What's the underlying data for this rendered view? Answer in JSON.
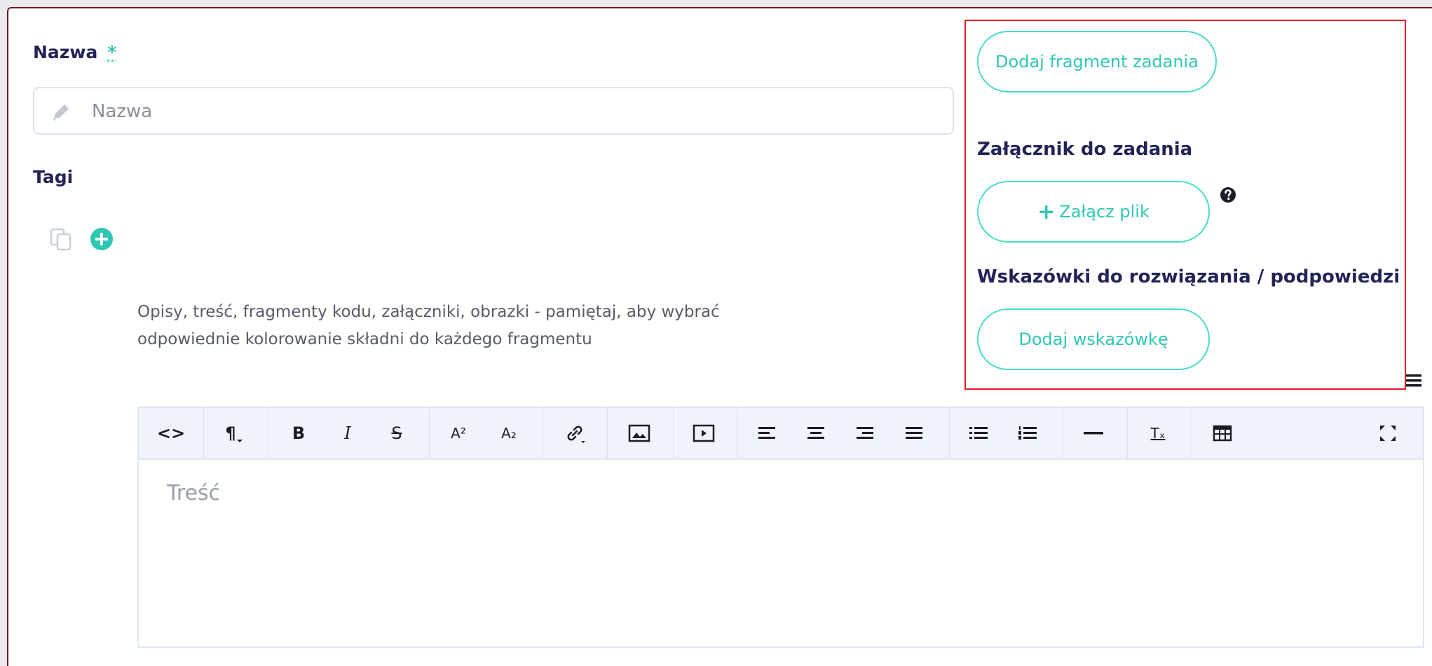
{
  "form": {
    "name_label": "Nazwa",
    "required_mark": "*",
    "name_placeholder": "Nazwa",
    "tags_label": "Tagi",
    "description": "Opisy, treść, fragmenty kodu, załączniki, obrazki - pamiętaj, aby wybrać odpowiednie kolorowanie składni do każdego fragmentu"
  },
  "panel": {
    "add_fragment_button": "Dodaj fragment zadania",
    "attachment_heading": "Załącznik do zadania",
    "attach_plus": "+",
    "attach_file_button": "Załącz plik",
    "hints_heading": "Wskazówki do rozwiązania / podpowiedzi",
    "add_hint_button": "Dodaj wskazówkę"
  },
  "editor": {
    "content_placeholder": "Treść",
    "toolbar": {
      "code_view": "<>",
      "paragraph": "¶",
      "bold": "B",
      "italic": "I",
      "strikethrough": "S",
      "superscript": "A²",
      "subscript": "A₂",
      "clear_format": "Tₓ"
    }
  },
  "colors": {
    "accent": "#2fc6b4",
    "heading": "#222356",
    "highlight_border": "#e21c25"
  }
}
